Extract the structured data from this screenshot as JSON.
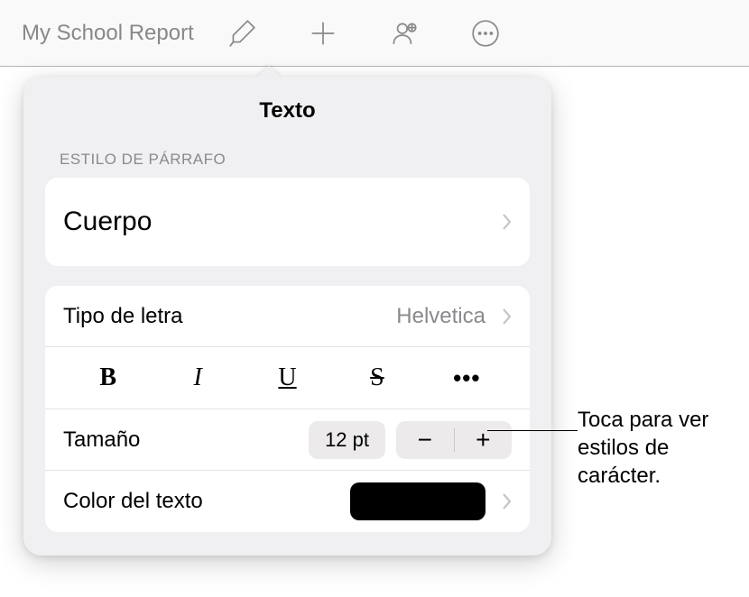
{
  "toolbar": {
    "doc_title": "My School Report"
  },
  "popover": {
    "title": "Texto",
    "section_paragraph": "ESTILO DE PÁRRAFO",
    "paragraph_style": "Cuerpo",
    "font_label": "Tipo de letra",
    "font_value": "Helvetica",
    "styles": {
      "bold": "B",
      "italic": "I",
      "underline": "U",
      "strike": "S",
      "more": "•••"
    },
    "size_label": "Tamaño",
    "size_value": "12 pt",
    "stepper_minus": "−",
    "stepper_plus": "+",
    "text_color_label": "Color del texto",
    "text_color": "#000000"
  },
  "callout": "Toca para ver estilos de carácter."
}
